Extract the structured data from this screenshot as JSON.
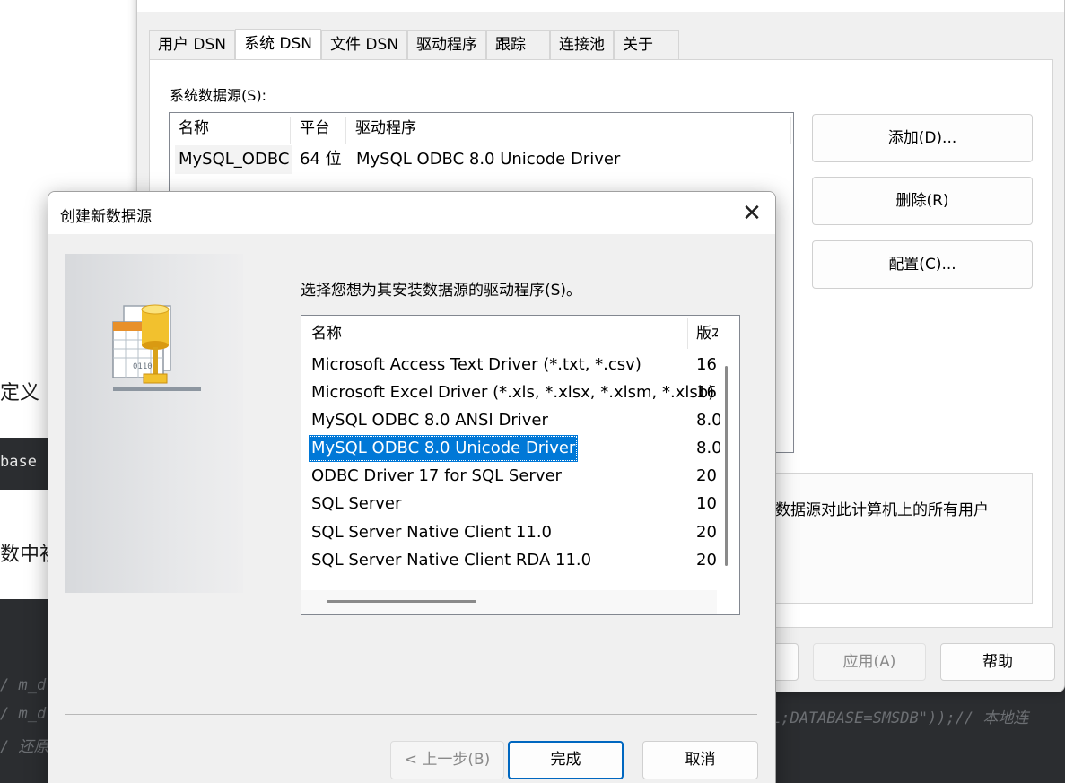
{
  "background_page": {
    "text_definition": "定义",
    "code_chip": "base",
    "text_initialize": "数中初",
    "code_lines": [
      "/ m_d",
      "/ m_d",
      "/ 还原"
    ],
    "code_connection_fragment": "L;DATABASE=SMSDB\"));// 本地连"
  },
  "odbc_admin": {
    "tabs": [
      "用户 DSN",
      "系统 DSN",
      "文件 DSN",
      "驱动程序",
      "跟踪",
      "连接池",
      "关于"
    ],
    "active_tab": "系统 DSN",
    "list_label": "系统数据源(S):",
    "columns": [
      "名称",
      "平台",
      "驱动程序"
    ],
    "rows": [
      {
        "name": "MySQL_ODBC",
        "platform": "64 位",
        "driver": "MySQL ODBC 8.0 Unicode Driver"
      }
    ],
    "buttons": {
      "add": "添加(D)...",
      "remove": "删除(R)",
      "configure": "配置(C)..."
    },
    "info_text": "数据源对此计算机上的所有用户",
    "bottom_buttons": {
      "apply": "应用(A)",
      "help": "帮助"
    }
  },
  "create_dialog": {
    "title": "创建新数据源",
    "prompt": "选择您想为其安装数据源的驱动程序(S)。",
    "columns": [
      "名称",
      "版本"
    ],
    "drivers": [
      {
        "name": "Microsoft Access Text Driver (*.txt, *.csv)",
        "version": "16"
      },
      {
        "name": "Microsoft Excel Driver (*.xls, *.xlsx, *.xlsm, *.xlsb)",
        "version": "16"
      },
      {
        "name": "MySQL ODBC 8.0 ANSI Driver",
        "version": "8.0"
      },
      {
        "name": "MySQL ODBC 8.0 Unicode Driver",
        "version": "8.0"
      },
      {
        "name": "ODBC Driver 17 for SQL Server",
        "version": "20"
      },
      {
        "name": "SQL Server",
        "version": "10"
      },
      {
        "name": "SQL Server Native Client 11.0",
        "version": "20"
      },
      {
        "name": "SQL Server Native Client RDA 11.0",
        "version": "20"
      }
    ],
    "selected_driver": "MySQL ODBC 8.0 Unicode Driver",
    "buttons": {
      "back": "< 上一步(B)",
      "finish": "完成",
      "cancel": "取消"
    },
    "icons": {
      "close": "close-icon",
      "wizard": "database-network-icon"
    }
  },
  "colors": {
    "selection": "#0078d7",
    "default_button_border": "#0067c0",
    "code_background": "#2b2d30"
  }
}
